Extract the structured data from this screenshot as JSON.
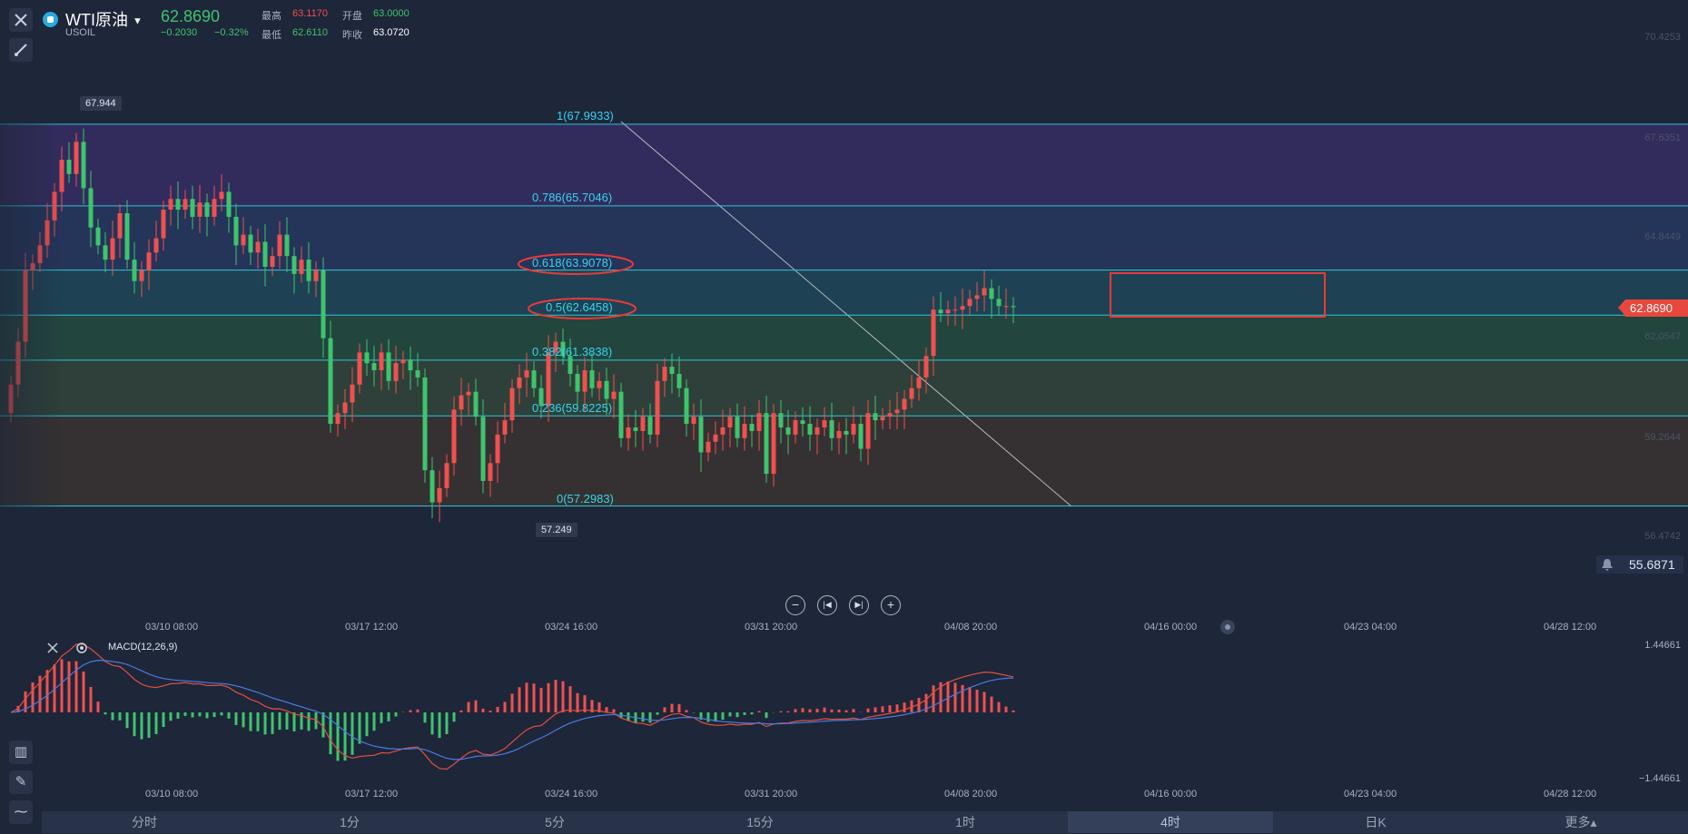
{
  "header": {
    "symbol": "WTI原油",
    "code": "USOIL",
    "last_price": "62.8690",
    "change": "−0.2030",
    "change_pct": "−0.32%",
    "high_label": "最高",
    "high_value": "63.1170",
    "low_label": "最低",
    "low_value": "62.6110",
    "open_label": "开盘",
    "open_value": "63.0000",
    "prev_close_label": "昨收",
    "prev_close_value": "63.0720"
  },
  "price_axis": {
    "ticks": [
      "70.4253",
      "67.6351",
      "64.8449",
      "62.0547",
      "59.2644",
      "56.4742"
    ],
    "current_tag": "62.8690",
    "alert_value": "55.6871"
  },
  "markers": {
    "high_label": "67.944",
    "low_label": "57.249"
  },
  "fib": [
    {
      "label": "1(67.9933)",
      "value": 67.9933
    },
    {
      "label": "0.786(65.7046)",
      "value": 65.7046
    },
    {
      "label": "0.618(63.9078)",
      "value": 63.9078
    },
    {
      "label": "0.5(62.6458)",
      "value": 62.6458
    },
    {
      "label": "0.382(61.3838)",
      "value": 61.3838
    },
    {
      "label": "0.236(59.8225)",
      "value": 59.8225
    },
    {
      "label": "0(57.2983)",
      "value": 57.2983
    }
  ],
  "time_axis": [
    "03/10 08:00",
    "03/17 12:00",
    "03/24 16:00",
    "03/31 20:00",
    "04/08 20:00",
    "04/16 00:00",
    "04/23 04:00",
    "04/28 12:00"
  ],
  "macd": {
    "title": "MACD(12,26,9)",
    "top_value": "1.44661",
    "bottom_value": "−1.44661"
  },
  "period_tabs": [
    "分时",
    "1分",
    "5分",
    "15分",
    "1时",
    "4时",
    "日K",
    "更多▴"
  ],
  "active_tab": "4时",
  "colors": {
    "up": "#f0504f",
    "down": "#3ec46d",
    "fib_line": "#2fc7d6",
    "fib_text": "#35d4f0",
    "highlight": "#e83a3a",
    "background": "#1e2639"
  },
  "icons": [
    "close-icon",
    "draw-tool-icon",
    "settings-icon",
    "indicator-icon",
    "pencil-icon",
    "line-chart-icon",
    "bell-icon",
    "zoom-out-icon",
    "rewind-icon",
    "forward-icon",
    "zoom-in-icon",
    "dropdown-caret-icon"
  ],
  "chart_data": {
    "type": "candlestick",
    "symbol": "USOIL",
    "ylim": [
      56.4742,
      70.4253
    ],
    "closes": [
      60.7,
      61.9,
      63.9,
      64.1,
      64.6,
      65.3,
      66.1,
      67.0,
      66.6,
      67.5,
      66.2,
      65.1,
      64.6,
      64.2,
      64.8,
      65.5,
      64.2,
      63.6,
      63.9,
      64.4,
      64.8,
      65.6,
      65.9,
      65.6,
      65.9,
      65.4,
      65.8,
      65.4,
      65.9,
      66.1,
      65.4,
      64.6,
      64.9,
      64.4,
      64.7,
      64.0,
      64.3,
      64.9,
      64.3,
      63.8,
      64.2,
      63.6,
      63.9,
      62.0,
      59.6,
      59.9,
      60.2,
      60.7,
      61.6,
      61.3,
      61.1,
      61.6,
      60.8,
      61.3,
      61.4,
      61.1,
      60.9,
      58.3,
      57.4,
      57.8,
      58.5,
      60.0,
      60.4,
      60.5,
      59.8,
      58.0,
      58.5,
      59.3,
      59.7,
      60.6,
      60.9,
      61.1,
      60.6,
      60.1,
      61.6,
      61.9,
      61.5,
      61.0,
      60.5,
      61.1,
      60.6,
      60.8,
      60.3,
      60.5,
      59.2,
      59.5,
      59.4,
      59.8,
      59.3,
      60.8,
      61.2,
      61.0,
      60.6,
      59.6,
      59.8,
      58.8,
      59.1,
      59.3,
      59.5,
      59.8,
      59.2,
      59.6,
      59.4,
      59.9,
      58.2,
      59.9,
      59.5,
      59.3,
      59.7,
      59.6,
      59.3,
      59.5,
      59.7,
      59.2,
      59.4,
      59.3,
      59.6,
      58.9,
      59.9,
      59.7,
      59.8,
      59.9,
      60.0,
      60.3,
      60.6,
      60.9,
      61.5,
      62.8,
      62.7,
      62.8,
      62.8,
      62.9,
      63.1,
      63.2,
      63.4,
      63.1,
      62.9,
      62.9,
      62.87
    ]
  }
}
